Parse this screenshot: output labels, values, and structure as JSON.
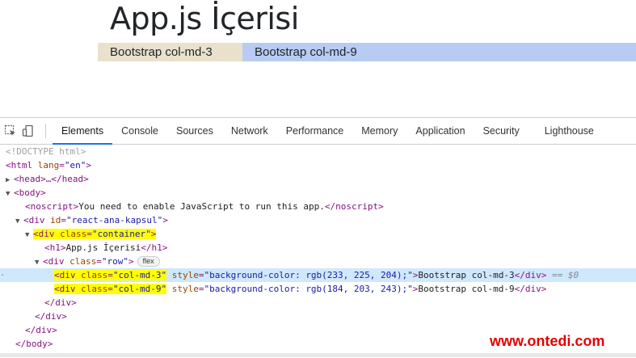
{
  "page": {
    "title": "App.js İçerisi",
    "col3_text": "Bootstrap col-md-3",
    "col9_text": "Bootstrap col-md-9",
    "col3_color": "#e9e1cc",
    "col9_color": "#b8cbf3"
  },
  "devtools": {
    "tabs": [
      {
        "label": "Elements",
        "active": true
      },
      {
        "label": "Console"
      },
      {
        "label": "Sources"
      },
      {
        "label": "Network"
      },
      {
        "label": "Performance"
      },
      {
        "label": "Memory"
      },
      {
        "label": "Application"
      },
      {
        "label": "Security"
      },
      {
        "label": "Lighthouse"
      }
    ],
    "icons": [
      "inspect-element-icon",
      "device-toolbar-icon"
    ],
    "dom": {
      "doctype": "<!DOCTYPE html>",
      "html_open": "<html ",
      "html_attr": "lang",
      "html_val": "\"en\"",
      "head_line": "<head>…</head>",
      "body_open": "<body>",
      "noscript_open": "<noscript>",
      "noscript_text": "You need to enable JavaScript to run this app.",
      "noscript_close": "</noscript>",
      "div_open": "<div ",
      "id_attr": "id",
      "id_val": "\"react-ana-kapsul\"",
      "container_attr": "class",
      "container_val": "\"container\"",
      "h1_open": "<h1>",
      "h1_text": "App.js İçerisi",
      "h1_close": "</h1>",
      "row_val": "\"row\"",
      "flex_badge": "flex",
      "style_attr": "style",
      "col3_class": "\"col-md-3\"",
      "col3_style": "\"background-color: rgb(233, 225, 204);\"",
      "col3_text": "Bootstrap col-md-3",
      "col9_class": "\"col-md-9\"",
      "col9_style": "\"background-color: rgb(184, 203, 243);\"",
      "col9_text": "Bootstrap col-md-9",
      "div_close": "</div>",
      "body_close": "</body>",
      "eq0": "== $0"
    }
  },
  "watermark": "www.ontedi.com",
  "colors": {
    "tag": "#881280",
    "attr": "#994500",
    "value": "#1a1aa6",
    "highlight": "#ffff00",
    "selected_row": "#cfe8fc",
    "watermark": "#e60000",
    "active_tab": "#1a73e8"
  }
}
